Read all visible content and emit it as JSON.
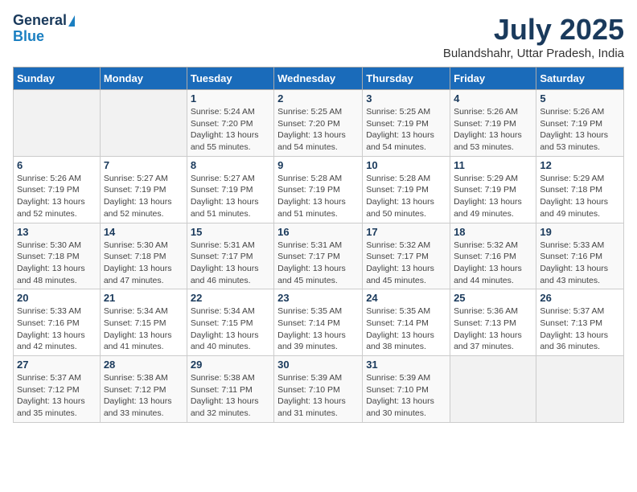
{
  "logo": {
    "line1": "General",
    "line2": "Blue"
  },
  "title": "July 2025",
  "location": "Bulandshahr, Uttar Pradesh, India",
  "weekdays": [
    "Sunday",
    "Monday",
    "Tuesday",
    "Wednesday",
    "Thursday",
    "Friday",
    "Saturday"
  ],
  "weeks": [
    [
      {
        "day": "",
        "info": ""
      },
      {
        "day": "",
        "info": ""
      },
      {
        "day": "1",
        "info": "Sunrise: 5:24 AM\nSunset: 7:20 PM\nDaylight: 13 hours\nand 55 minutes."
      },
      {
        "day": "2",
        "info": "Sunrise: 5:25 AM\nSunset: 7:20 PM\nDaylight: 13 hours\nand 54 minutes."
      },
      {
        "day": "3",
        "info": "Sunrise: 5:25 AM\nSunset: 7:19 PM\nDaylight: 13 hours\nand 54 minutes."
      },
      {
        "day": "4",
        "info": "Sunrise: 5:26 AM\nSunset: 7:19 PM\nDaylight: 13 hours\nand 53 minutes."
      },
      {
        "day": "5",
        "info": "Sunrise: 5:26 AM\nSunset: 7:19 PM\nDaylight: 13 hours\nand 53 minutes."
      }
    ],
    [
      {
        "day": "6",
        "info": "Sunrise: 5:26 AM\nSunset: 7:19 PM\nDaylight: 13 hours\nand 52 minutes."
      },
      {
        "day": "7",
        "info": "Sunrise: 5:27 AM\nSunset: 7:19 PM\nDaylight: 13 hours\nand 52 minutes."
      },
      {
        "day": "8",
        "info": "Sunrise: 5:27 AM\nSunset: 7:19 PM\nDaylight: 13 hours\nand 51 minutes."
      },
      {
        "day": "9",
        "info": "Sunrise: 5:28 AM\nSunset: 7:19 PM\nDaylight: 13 hours\nand 51 minutes."
      },
      {
        "day": "10",
        "info": "Sunrise: 5:28 AM\nSunset: 7:19 PM\nDaylight: 13 hours\nand 50 minutes."
      },
      {
        "day": "11",
        "info": "Sunrise: 5:29 AM\nSunset: 7:19 PM\nDaylight: 13 hours\nand 49 minutes."
      },
      {
        "day": "12",
        "info": "Sunrise: 5:29 AM\nSunset: 7:18 PM\nDaylight: 13 hours\nand 49 minutes."
      }
    ],
    [
      {
        "day": "13",
        "info": "Sunrise: 5:30 AM\nSunset: 7:18 PM\nDaylight: 13 hours\nand 48 minutes."
      },
      {
        "day": "14",
        "info": "Sunrise: 5:30 AM\nSunset: 7:18 PM\nDaylight: 13 hours\nand 47 minutes."
      },
      {
        "day": "15",
        "info": "Sunrise: 5:31 AM\nSunset: 7:17 PM\nDaylight: 13 hours\nand 46 minutes."
      },
      {
        "day": "16",
        "info": "Sunrise: 5:31 AM\nSunset: 7:17 PM\nDaylight: 13 hours\nand 45 minutes."
      },
      {
        "day": "17",
        "info": "Sunrise: 5:32 AM\nSunset: 7:17 PM\nDaylight: 13 hours\nand 45 minutes."
      },
      {
        "day": "18",
        "info": "Sunrise: 5:32 AM\nSunset: 7:16 PM\nDaylight: 13 hours\nand 44 minutes."
      },
      {
        "day": "19",
        "info": "Sunrise: 5:33 AM\nSunset: 7:16 PM\nDaylight: 13 hours\nand 43 minutes."
      }
    ],
    [
      {
        "day": "20",
        "info": "Sunrise: 5:33 AM\nSunset: 7:16 PM\nDaylight: 13 hours\nand 42 minutes."
      },
      {
        "day": "21",
        "info": "Sunrise: 5:34 AM\nSunset: 7:15 PM\nDaylight: 13 hours\nand 41 minutes."
      },
      {
        "day": "22",
        "info": "Sunrise: 5:34 AM\nSunset: 7:15 PM\nDaylight: 13 hours\nand 40 minutes."
      },
      {
        "day": "23",
        "info": "Sunrise: 5:35 AM\nSunset: 7:14 PM\nDaylight: 13 hours\nand 39 minutes."
      },
      {
        "day": "24",
        "info": "Sunrise: 5:35 AM\nSunset: 7:14 PM\nDaylight: 13 hours\nand 38 minutes."
      },
      {
        "day": "25",
        "info": "Sunrise: 5:36 AM\nSunset: 7:13 PM\nDaylight: 13 hours\nand 37 minutes."
      },
      {
        "day": "26",
        "info": "Sunrise: 5:37 AM\nSunset: 7:13 PM\nDaylight: 13 hours\nand 36 minutes."
      }
    ],
    [
      {
        "day": "27",
        "info": "Sunrise: 5:37 AM\nSunset: 7:12 PM\nDaylight: 13 hours\nand 35 minutes."
      },
      {
        "day": "28",
        "info": "Sunrise: 5:38 AM\nSunset: 7:12 PM\nDaylight: 13 hours\nand 33 minutes."
      },
      {
        "day": "29",
        "info": "Sunrise: 5:38 AM\nSunset: 7:11 PM\nDaylight: 13 hours\nand 32 minutes."
      },
      {
        "day": "30",
        "info": "Sunrise: 5:39 AM\nSunset: 7:10 PM\nDaylight: 13 hours\nand 31 minutes."
      },
      {
        "day": "31",
        "info": "Sunrise: 5:39 AM\nSunset: 7:10 PM\nDaylight: 13 hours\nand 30 minutes."
      },
      {
        "day": "",
        "info": ""
      },
      {
        "day": "",
        "info": ""
      }
    ]
  ]
}
